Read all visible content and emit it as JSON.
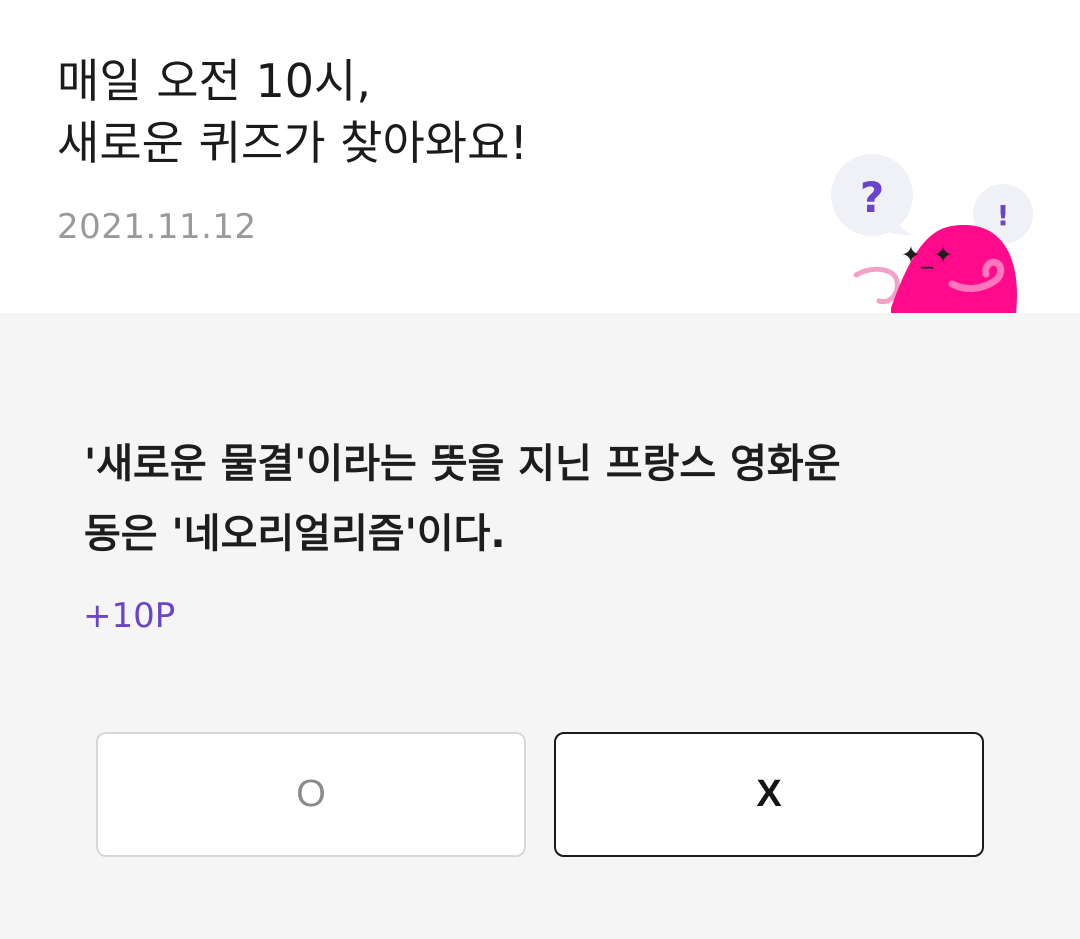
{
  "header": {
    "title_line1": "매일 오전 10시,",
    "title_line2": "새로운 퀴즈가 찾아와요!",
    "date": "2021.11.12",
    "mascot": {
      "question_bubble": "?",
      "exclaim_bubble": "!",
      "face": "✦_✦"
    }
  },
  "quiz": {
    "question_line1": "'새로운 물결'이라는 뜻을 지닌 프랑스 영화운",
    "question_line2": "동은 '네오리얼리즘'이다.",
    "points": "+10P",
    "answer_o": "O",
    "answer_x": "X"
  },
  "colors": {
    "accent_purple": "#6b45c9",
    "mascot_pink": "#ff0a8a",
    "panel_background": "#f5f5f5",
    "border_light": "#d8d8d8",
    "border_dark": "#1a1a1a"
  },
  "icons": {
    "mascot": "pink-blob-mascot-icon",
    "question_bubble": "question-mark-bubble-icon",
    "exclaim_bubble": "exclamation-bubble-icon"
  }
}
